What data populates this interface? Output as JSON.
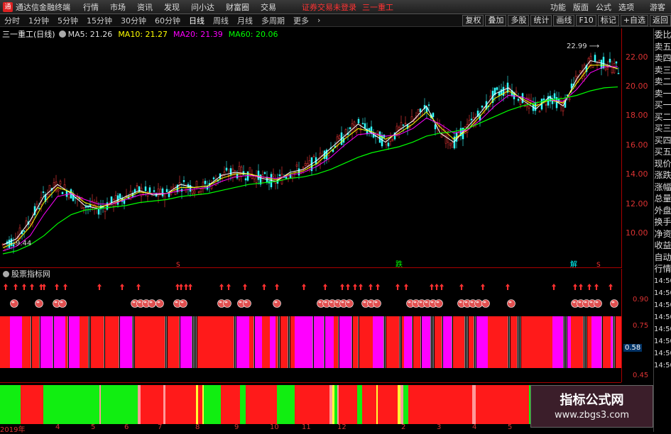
{
  "menubar": {
    "app_title": "通达信金融终端",
    "items": [
      "行情",
      "市场",
      "资讯",
      "发现",
      "问小达",
      "财富圈",
      "交易"
    ],
    "login": "证券交易未登录",
    "stock": "三一重工",
    "right_items": [
      "功能",
      "版面",
      "公式",
      "选项"
    ],
    "guest": "游客"
  },
  "toolbar": {
    "periods": [
      "分时",
      "1分钟",
      "5分钟",
      "15分钟",
      "30分钟",
      "60分钟",
      "日线",
      "周线",
      "月线",
      "多周期",
      "更多"
    ],
    "active": "日线",
    "right_buttons": [
      "复权",
      "叠加",
      "多股",
      "统计",
      "画线",
      "F10",
      "标记",
      "+自选",
      "返回"
    ]
  },
  "stock": {
    "name": "三一重工(日线)",
    "ma5": "MA5: 21.26",
    "ma10": "MA10: 21.27",
    "ma20": "MA20: 21.39",
    "ma60": "MA60: 20.06"
  },
  "price_axis": [
    "22.00",
    "20.00",
    "18.00",
    "16.00",
    "14.00",
    "12.00",
    "10.00"
  ],
  "annotations": {
    "high": "22.99",
    "low": "9.44"
  },
  "signals": {
    "die": "跌",
    "jie": "解"
  },
  "indicator": {
    "title": "股票指标网",
    "ticks": [
      "0.90",
      "0.75",
      "0.58",
      "0.45"
    ],
    "current": "0.58"
  },
  "right_panel": [
    "委比",
    "卖五",
    "卖四",
    "卖三",
    "卖二",
    "卖一",
    "买一",
    "买二",
    "买三",
    "买四",
    "买五",
    "现价",
    "涨跌",
    "涨幅",
    "总量",
    "外盘",
    "换手",
    "净资",
    "收益",
    "自动",
    "行情",
    "14:50",
    "14:50",
    "14:50",
    "14:50",
    "14:50",
    "14:50",
    "14:50",
    "14:50"
  ],
  "dates": [
    "2019年",
    "4",
    "5",
    "6",
    "7",
    "8",
    "9",
    "10",
    "11",
    "12",
    "2",
    "3",
    "4",
    "5"
  ],
  "watermark": {
    "title": "指标公式网",
    "url": "www.zbgs3.com"
  },
  "colors": {
    "up": "#ff3333",
    "ma5": "#ffffff",
    "ma10": "#ffff00",
    "ma20": "#ff00ff",
    "ma60": "#00ff00"
  },
  "chart_data": {
    "type": "line",
    "series": [
      {
        "name": "MA5",
        "values": [
          9.6,
          10.0,
          11.2,
          12.8,
          13.6,
          13.0,
          12.2,
          12.0,
          12.4,
          12.8,
          13.2,
          12.9,
          13.0,
          13.6,
          13.4,
          13.5,
          14.2,
          14.4,
          14.3,
          14.0,
          13.8,
          14.4,
          14.6,
          15.2,
          16.0,
          16.8,
          17.6,
          17.0,
          16.4,
          17.2,
          17.8,
          18.8,
          17.0,
          16.4,
          17.4,
          18.4,
          19.6,
          20.0,
          19.2,
          18.6,
          19.4,
          18.8,
          20.6,
          21.8,
          21.6,
          21.26
        ]
      },
      {
        "name": "MA10",
        "values": [
          9.4,
          9.8,
          10.8,
          12.4,
          13.4,
          13.1,
          12.4,
          12.1,
          12.3,
          12.7,
          13.1,
          13.0,
          13.0,
          13.4,
          13.4,
          13.5,
          14.0,
          14.3,
          14.3,
          14.1,
          13.9,
          14.3,
          14.5,
          15.0,
          15.8,
          16.6,
          17.3,
          17.1,
          16.6,
          17.0,
          17.6,
          18.4,
          17.4,
          16.6,
          17.2,
          18.2,
          19.3,
          19.8,
          19.3,
          18.8,
          19.2,
          19.0,
          20.3,
          21.5,
          21.5,
          21.27
        ]
      },
      {
        "name": "MA20",
        "values": [
          9.2,
          9.5,
          10.2,
          11.6,
          12.8,
          13.0,
          12.6,
          12.3,
          12.3,
          12.6,
          12.9,
          13.0,
          13.0,
          13.2,
          13.3,
          13.4,
          13.8,
          14.1,
          14.2,
          14.1,
          14.0,
          14.2,
          14.4,
          14.8,
          15.4,
          16.2,
          16.9,
          17.0,
          16.8,
          16.9,
          17.3,
          18.0,
          17.6,
          17.0,
          17.2,
          17.9,
          18.8,
          19.5,
          19.4,
          19.0,
          19.2,
          19.1,
          19.9,
          21.0,
          21.4,
          21.39
        ]
      },
      {
        "name": "MA60",
        "values": [
          9.0,
          9.2,
          9.6,
          10.2,
          11.0,
          11.6,
          11.9,
          12.0,
          12.1,
          12.2,
          12.4,
          12.5,
          12.6,
          12.8,
          12.9,
          13.0,
          13.2,
          13.4,
          13.6,
          13.7,
          13.8,
          14.0,
          14.1,
          14.3,
          14.6,
          15.0,
          15.4,
          15.7,
          15.9,
          16.1,
          16.4,
          16.8,
          17.0,
          17.1,
          17.3,
          17.7,
          18.1,
          18.5,
          18.8,
          19.0,
          19.2,
          19.3,
          19.5,
          19.8,
          20.0,
          20.06
        ]
      }
    ],
    "ylim": [
      9.0,
      23.0
    ]
  }
}
